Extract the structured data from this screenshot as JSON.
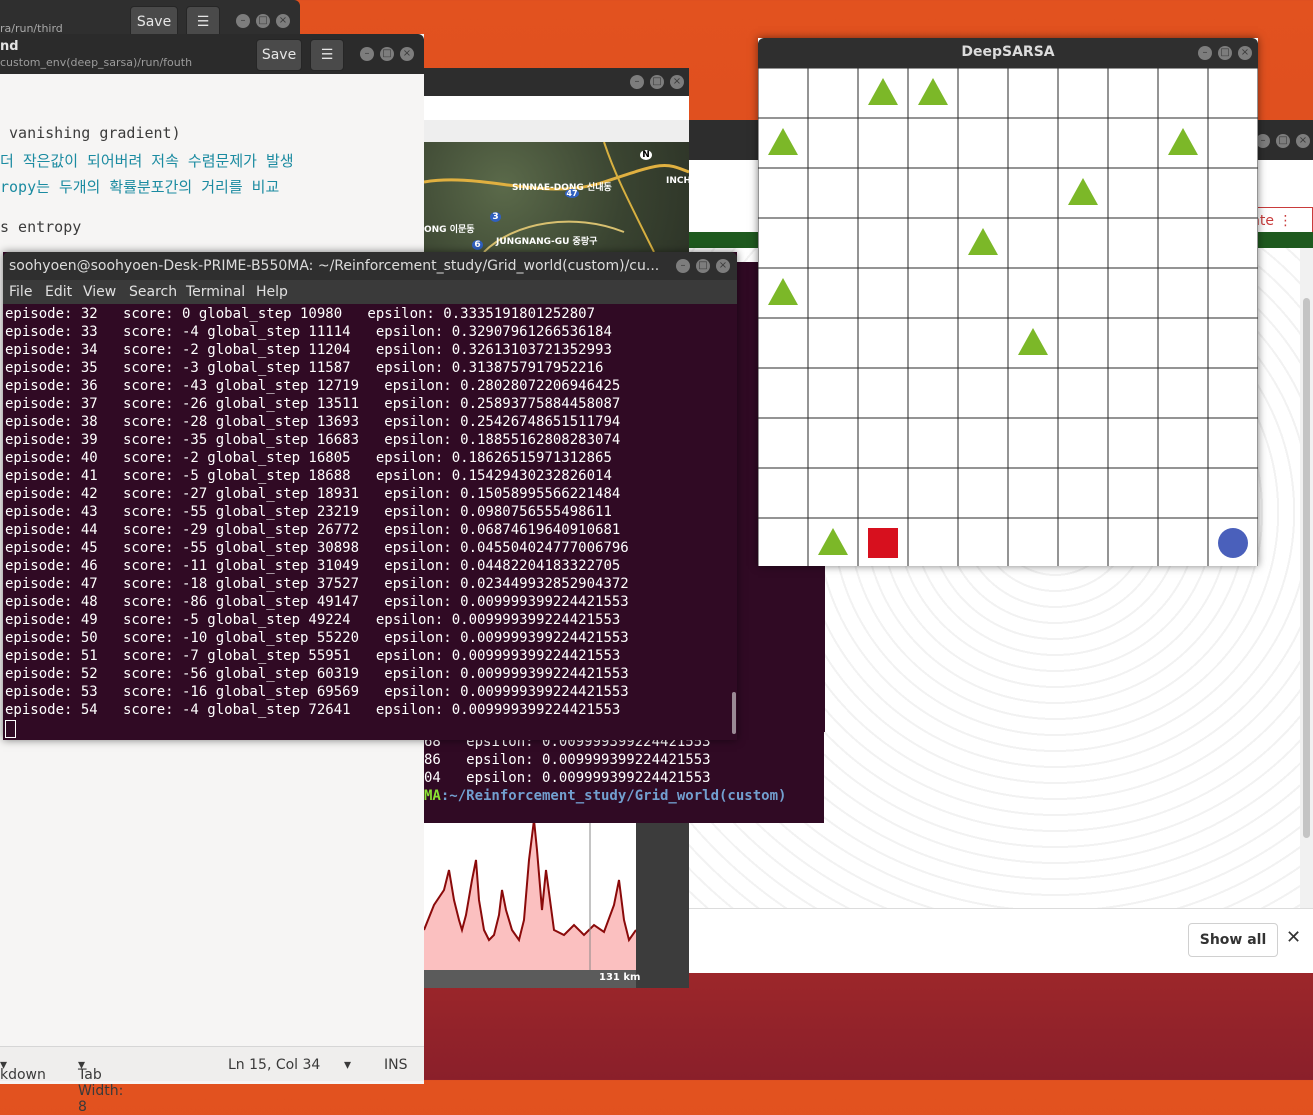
{
  "editor_back": {
    "path": "ra/run/third",
    "save_label": "Save",
    "menu_icon": "hamburger-icon"
  },
  "editor_front": {
    "title": "nd",
    "path": "custom_env(deep_sarsa)/run/fouth",
    "save_label": "Save",
    "lines": [
      " vanishing gradient)",
      "더 작은값이 되어버려 저속 수렴문제가 발생",
      "ropy는 두개의 확률분포간의 거리를 비교",
      "",
      "s entropy"
    ],
    "status": {
      "language": "kdown",
      "tab_width": "Tab Width: 8",
      "position": "Ln 15, Col 34",
      "mode": "INS"
    }
  },
  "map_window": {
    "labels": [
      "SINNAE-DONG 신내동",
      "JUNGNANG-GU 중랑구",
      "ONG 이문동",
      "INCH",
      "N",
      "3",
      "6",
      "47"
    ],
    "scale": "131 km"
  },
  "browser": {
    "pill_text": "nte",
    "show_all_label": "Show all",
    "close_label": "✕"
  },
  "terminal_back": {
    "lines": [
      {
        "num": "68",
        "eps": "epsilon: 0.009999399224421553"
      },
      {
        "num": "86",
        "eps": "epsilon: 0.009999399224421553"
      },
      {
        "num": "04",
        "eps": "epsilon: 0.009999399224421553"
      }
    ],
    "prompt_host": "MA",
    "prompt_path": ":~/Reinforcement_study/Grid_world(custom)"
  },
  "terminal": {
    "title": "soohyoen@soohyoen-Desk-PRIME-B550MA: ~/Reinforcement_study/Grid_world(custom)/cu...",
    "menu": [
      "File",
      "Edit",
      "View",
      "Search",
      "Terminal",
      "Help"
    ],
    "rows": [
      "episode: 32   score: 0 global_step 10980   epsilon: 0.3335191801252807",
      "episode: 33   score: -4 global_step 11114   epsilon: 0.32907961266536184",
      "episode: 34   score: -2 global_step 11204   epsilon: 0.32613103721352993",
      "episode: 35   score: -3 global_step 11587   epsilon: 0.3138757917952216",
      "episode: 36   score: -43 global_step 12719   epsilon: 0.28028072206946425",
      "episode: 37   score: -26 global_step 13511   epsilon: 0.25893775884458087",
      "episode: 38   score: -28 global_step 13693   epsilon: 0.25426748651511794",
      "episode: 39   score: -35 global_step 16683   epsilon: 0.18855162808283074",
      "episode: 40   score: -2 global_step 16805   epsilon: 0.18626515971312865",
      "episode: 41   score: -5 global_step 18688   epsilon: 0.15429430232826014",
      "episode: 42   score: -27 global_step 18931   epsilon: 0.15058995566221484",
      "episode: 43   score: -55 global_step 23219   epsilon: 0.0980756555498611",
      "episode: 44   score: -29 global_step 26772   epsilon: 0.06874619640910681",
      "episode: 45   score: -55 global_step 30898   epsilon: 0.045504024777006796",
      "episode: 46   score: -11 global_step 31049   epsilon: 0.04482204183322705",
      "episode: 47   score: -18 global_step 37527   epsilon: 0.023449932852904372",
      "episode: 48   score: -86 global_step 49147   epsilon: 0.009999399224421553",
      "episode: 49   score: -5 global_step 49224   epsilon: 0.009999399224421553",
      "episode: 50   score: -10 global_step 55220   epsilon: 0.009999399224421553",
      "episode: 51   score: -7 global_step 55951   epsilon: 0.009999399224421553",
      "episode: 52   score: -56 global_step 60319   epsilon: 0.009999399224421553",
      "episode: 53   score: -16 global_step 69569   epsilon: 0.009999399224421553",
      "episode: 54   score: -4 global_step 72641   epsilon: 0.009999399224421553"
    ]
  },
  "deepsarsa": {
    "title": "DeepSARSA",
    "grid": {
      "rows": 10,
      "cols": 10
    },
    "triangles": [
      [
        0,
        2
      ],
      [
        0,
        3
      ],
      [
        1,
        0
      ],
      [
        1,
        8
      ],
      [
        2,
        6
      ],
      [
        3,
        4
      ],
      [
        4,
        0
      ],
      [
        5,
        5
      ],
      [
        9,
        1
      ]
    ],
    "agent_square": [
      9,
      2
    ],
    "goal_circle": [
      9,
      9
    ],
    "colors": {
      "triangle": "#7cb828",
      "square": "#d7101e",
      "circle": "#4a60bb",
      "grid": "#2a2a2a"
    }
  }
}
